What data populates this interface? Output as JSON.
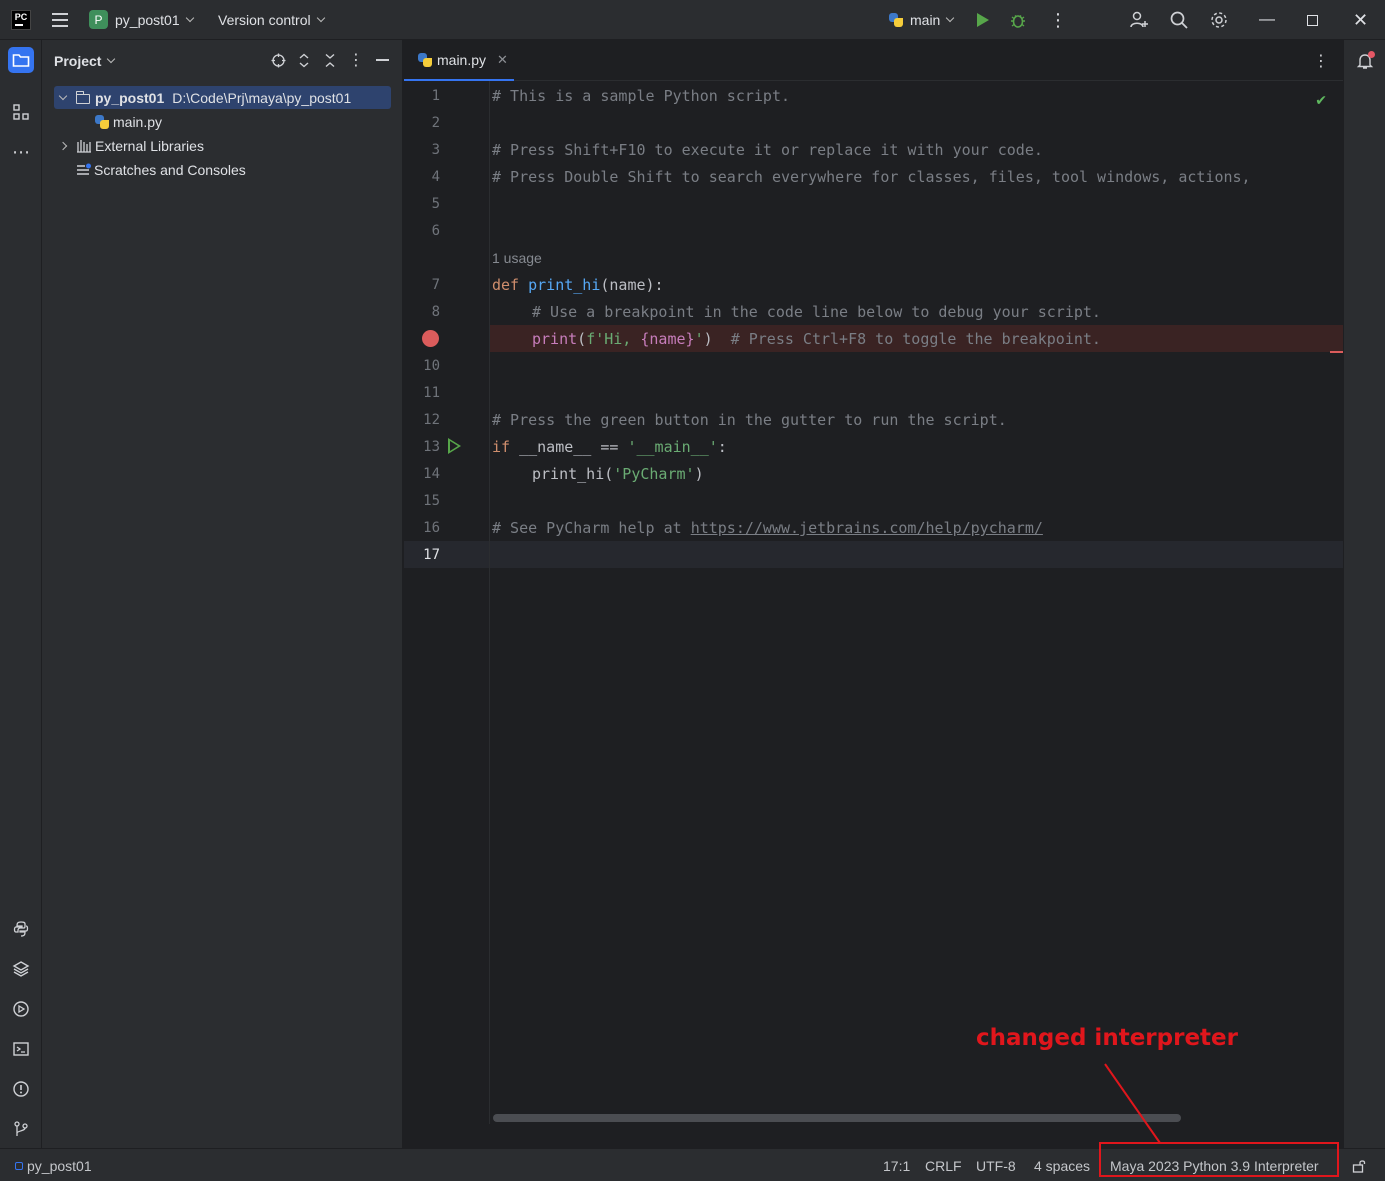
{
  "titlebar": {
    "app_logo": "PC",
    "project_badge": "P",
    "project_name": "py_post01",
    "vcs_label": "Version control",
    "run_config": "main"
  },
  "project_panel": {
    "title": "Project",
    "tree": [
      {
        "label": "py_post01",
        "path": "D:\\Code\\Prj\\maya\\py_post01"
      },
      {
        "label": "main.py"
      },
      {
        "label": "External Libraries"
      },
      {
        "label": "Scratches and Consoles"
      }
    ]
  },
  "editor": {
    "tab_label": "main.py",
    "usage_hint": "1 usage",
    "line_numbers": [
      "1",
      "2",
      "3",
      "4",
      "5",
      "6",
      "7",
      "8",
      "",
      "10",
      "11",
      "12",
      "13",
      "14",
      "15",
      "16",
      "17"
    ],
    "lines": {
      "l1": "# This is a sample Python script.",
      "l3": "# Press Shift+F10 to execute it or replace it with your code.",
      "l4": "# Press Double Shift to search everywhere for classes, files, tool windows, actions,",
      "l7_kw": "def",
      "l7_fn": "print_hi",
      "l7_rest": "(name):",
      "l8": "# Use a breakpoint in the code line below to debug your script.",
      "l9_fn": "print",
      "l9_p1": "(",
      "l9_str1": "f'Hi, ",
      "l9_ins": "{name}",
      "l9_str2": "'",
      "l9_p2": ")",
      "l9_comment": "# Press Ctrl+F8 to toggle the breakpoint.",
      "l12": "# Press the green button in the gutter to run the script.",
      "l13_kw": "if",
      "l13_mid": " __name__ == ",
      "l13_str": "'__main__'",
      "l13_end": ":",
      "l14_fn": "print_hi",
      "l14_p1": "(",
      "l14_str": "'PyCharm'",
      "l14_p2": ")",
      "l16_comment": "# See PyCharm help at ",
      "l16_link": "https://www.jetbrains.com/help/pycharm/"
    }
  },
  "statusbar": {
    "project": "py_post01",
    "position": "17:1",
    "line_sep": "CRLF",
    "encoding": "UTF-8",
    "indent": "4 spaces",
    "interpreter": "Maya 2023 Python 3.9 Interpreter"
  },
  "annotation": {
    "text": "changed interpreter",
    "color": "#e0161c"
  },
  "colors": {
    "accent": "#3574f0",
    "breakpoint": "#db5c5c",
    "run": "#57a64a"
  }
}
